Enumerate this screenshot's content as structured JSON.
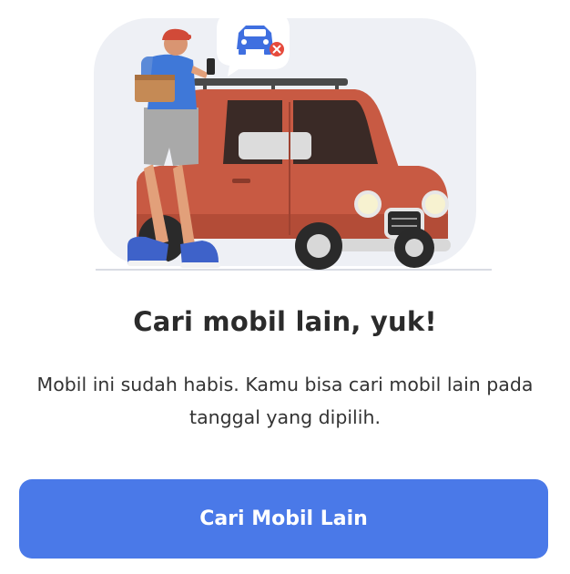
{
  "dialog": {
    "title": "Cari mobil lain, yuk!",
    "description": "Mobil ini sudah habis. Kamu bisa cari mobil lain pada tanggal yang dipilih.",
    "button_label": "Cari Mobil Lain"
  },
  "colors": {
    "primary_button": "#4a79e8",
    "car_body": "#c85a43",
    "unavailable_badge": "#e64a3c",
    "car_icon": "#3f6fe0"
  },
  "icons": {
    "illustration": "person-with-car-illustration",
    "badge": "car-unavailable-icon"
  }
}
